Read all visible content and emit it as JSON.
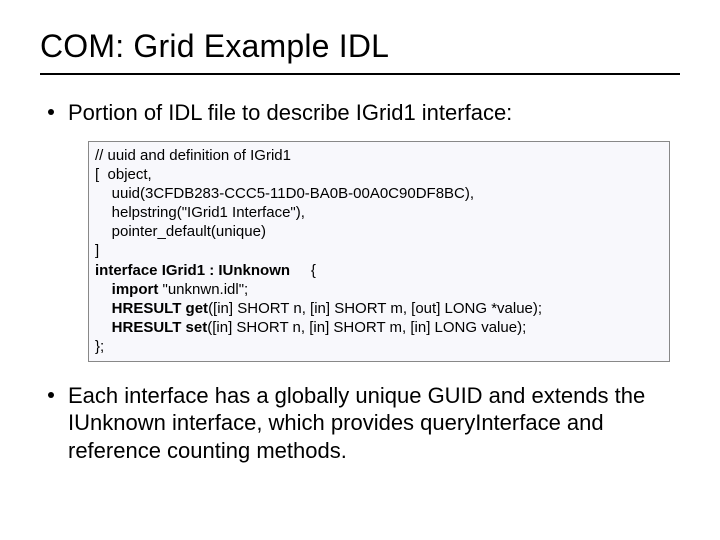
{
  "title": "COM: Grid Example IDL",
  "bullet1": "Portion of IDL file to describe IGrid1 interface:",
  "code": {
    "l1": "// uuid and definition of IGrid1",
    "l2a": "[  ",
    "l2b": "object,",
    "l3": "    uuid(3CFDB283-CCC5-11D0-BA0B-00A0C90DF8BC),",
    "l4": "    helpstring(\"IGrid1 Interface\"),",
    "l5": "    pointer_default(unique)",
    "l6": "]",
    "l7a": "interface IGrid1 : IUnknown",
    "l7b": "     {",
    "l8a": "    import",
    "l8b": " \"unknwn.idl\";",
    "l9a": "    HRESULT get",
    "l9b": "([in] SHORT n, [in] SHORT m, [out] LONG *value);",
    "l10a": "    HRESULT set",
    "l10b": "([in] SHORT n, [in] SHORT m, [in] LONG value);",
    "l11": "};"
  },
  "bullet2": "Each interface has a globally unique GUID and extends the IUnknown interface, which provides queryInterface and reference counting methods."
}
